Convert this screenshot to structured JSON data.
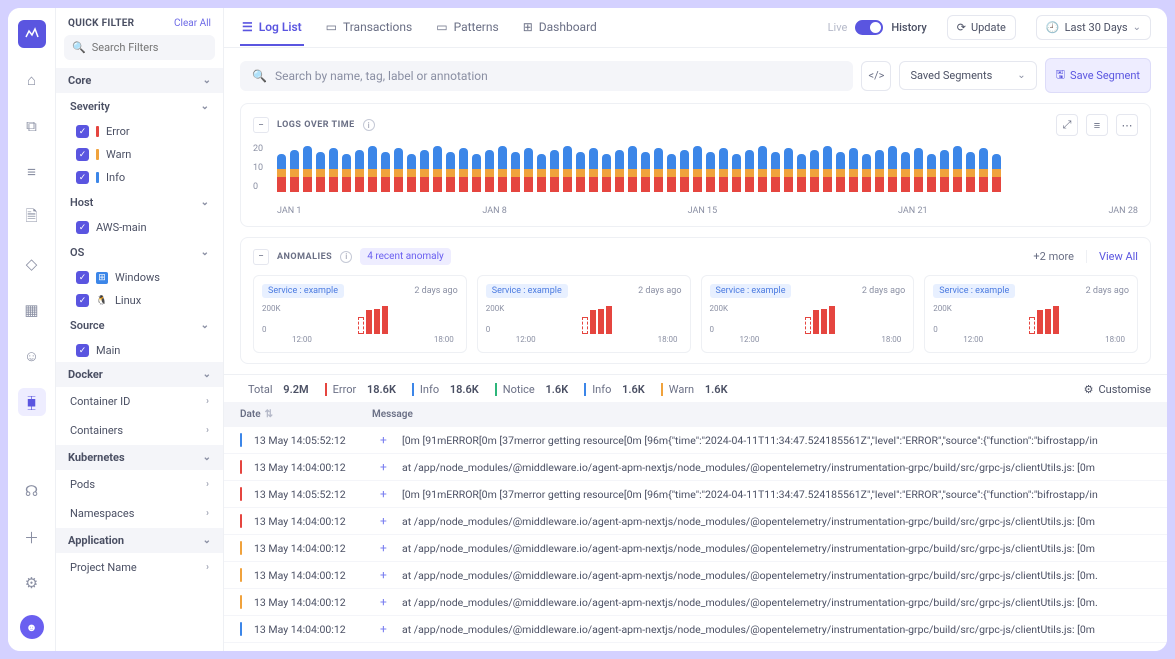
{
  "nav": {
    "items": [
      "home",
      "stack",
      "list",
      "file",
      "bell",
      "grid",
      "bot",
      "chart"
    ],
    "bottom": [
      "headset",
      "plus",
      "settings",
      "avatar"
    ]
  },
  "filter": {
    "title": "QUICK FILTER",
    "clear": "Clear All",
    "search_placeholder": "Search Filters",
    "groups": {
      "core": {
        "label": "Core",
        "severity": {
          "label": "Severity",
          "items": [
            {
              "label": "Error",
              "color": "#e5453f"
            },
            {
              "label": "Warn",
              "color": "#f0a23c"
            },
            {
              "label": "Info",
              "color": "#3c86e8"
            }
          ]
        },
        "host": {
          "label": "Host",
          "items": [
            {
              "label": "AWS-main"
            }
          ]
        },
        "os": {
          "label": "OS",
          "items": [
            {
              "label": "Windows",
              "icon": "⊞",
              "bg": "#3c86e8"
            },
            {
              "label": "Linux",
              "icon": "🐧",
              "bg": "#fff"
            }
          ]
        },
        "source": {
          "label": "Source",
          "items": [
            {
              "label": "Main"
            }
          ]
        }
      },
      "docker": {
        "label": "Docker",
        "links": [
          "Container ID",
          "Containers"
        ]
      },
      "kubernetes": {
        "label": "Kubernetes",
        "links": [
          "Pods",
          "Namespaces"
        ]
      },
      "application": {
        "label": "Application",
        "links": [
          "Project Name"
        ]
      }
    }
  },
  "topbar": {
    "tabs": [
      {
        "label": "Log List",
        "icon": "☰",
        "active": true
      },
      {
        "label": "Transactions",
        "icon": "▭"
      },
      {
        "label": "Patterns",
        "icon": "▭"
      },
      {
        "label": "Dashboard",
        "icon": "⊞"
      }
    ],
    "live": "Live",
    "history": "History",
    "update": "Update",
    "range": "Last 30 Days"
  },
  "searchbar": {
    "placeholder": "Search by name, tag, label or annotation",
    "segments_label": "Saved Segments",
    "save_label": "Save Segment"
  },
  "logs_over_time": {
    "title": "LOGS OVER TIME",
    "y": [
      "20",
      "10",
      "0"
    ],
    "x": [
      "JAN 1",
      "JAN 8",
      "JAN 15",
      "JAN 21",
      "JAN 28"
    ]
  },
  "anomalies": {
    "title": "ANOMALIES",
    "recent": "4 recent anomaly",
    "more": "+2 more",
    "viewall": "View All",
    "cards": [
      {
        "tag": "Service : example",
        "time": "2 days ago",
        "y": [
          "200K",
          "0"
        ],
        "x": [
          "12:00",
          "18:00"
        ]
      },
      {
        "tag": "Service : example",
        "time": "2 days ago",
        "y": [
          "200K",
          "0"
        ],
        "x": [
          "12:00",
          "18:00"
        ]
      },
      {
        "tag": "Service : example",
        "time": "2 days ago",
        "y": [
          "200K",
          "0"
        ],
        "x": [
          "12:00",
          "18:00"
        ]
      },
      {
        "tag": "Service : example",
        "time": "2 days ago",
        "y": [
          "200K",
          "0"
        ],
        "x": [
          "12:00",
          "18:00"
        ]
      }
    ]
  },
  "summary": {
    "total": {
      "lbl": "Total",
      "val": "9.2M"
    },
    "items": [
      {
        "lbl": "Error",
        "val": "18.6K",
        "color": "#e5453f"
      },
      {
        "lbl": "Info",
        "val": "18.6K",
        "color": "#3c86e8"
      },
      {
        "lbl": "Notice",
        "val": "1.6K",
        "color": "#2db57a"
      },
      {
        "lbl": "Info",
        "val": "1.6K",
        "color": "#3c86e8"
      },
      {
        "lbl": "Warn",
        "val": "1.6K",
        "color": "#f0a23c"
      }
    ],
    "customise": "Customise"
  },
  "table": {
    "head": {
      "date": "Date",
      "message": "Message"
    },
    "rows": [
      {
        "bar": "#3c86e8",
        "date": "13 May 14:05:52:12",
        "msg": "[0m [91mERROR[0m [37merror getting resource[0m [96m{\"time\":\"2024-04-11T11:34:47.524185561Z\",\"level\":\"ERROR\",\"source\":{\"function\":\"bifrostapp/in"
      },
      {
        "bar": "#e5453f",
        "date": "13 May 14:04:00:12",
        "msg": "at /app/node_modules/@middleware.io/agent-apm-nextjs/node_modules/@opentelemetry/instrumentation-grpc/build/src/grpc-js/clientUtils.js: [0m"
      },
      {
        "bar": "#e5453f",
        "date": "13 May 14:05:52:12",
        "msg": "[0m [91mERROR[0m [37merror getting resource[0m [96m{\"time\":\"2024-04-11T11:34:47.524185561Z\",\"level\":\"ERROR\",\"source\":{\"function\":\"bifrostapp/in"
      },
      {
        "bar": "#e5453f",
        "date": "13 May 14:04:00:12",
        "msg": "at /app/node_modules/@middleware.io/agent-apm-nextjs/node_modules/@opentelemetry/instrumentation-grpc/build/src/grpc-js/clientUtils.js: [0m"
      },
      {
        "bar": "#f0a23c",
        "date": "13 May 14:04:00:12",
        "msg": "at /app/node_modules/@middleware.io/agent-apm-nextjs/node_modules/@opentelemetry/instrumentation-grpc/build/src/grpc-js/clientUtils.js: [0m"
      },
      {
        "bar": "#f0a23c",
        "date": "13 May 14:04:00:12",
        "msg": "at /app/node_modules/@middleware.io/agent-apm-nextjs/node_modules/@opentelemetry/instrumentation-grpc/build/src/grpc-js/clientUtils.js: [0m."
      },
      {
        "bar": "#f0a23c",
        "date": "13 May 14:04:00:12",
        "msg": "at /app/node_modules/@middleware.io/agent-apm-nextjs/node_modules/@opentelemetry/instrumentation-grpc/build/src/grpc-js/clientUtils.js: [0m."
      },
      {
        "bar": "#3c86e8",
        "date": "13 May 14:04:00:12",
        "msg": "at /app/node_modules/@middleware.io/agent-apm-nextjs/node_modules/@opentelemetry/instrumentation-grpc/build/src/grpc-js/clientUtils.js: [0m"
      }
    ]
  },
  "chart_data": {
    "type": "bar",
    "stacked": true,
    "title": "LOGS OVER TIME",
    "ylabel": "",
    "ylim": [
      0,
      25
    ],
    "yticks": [
      0,
      10,
      20
    ],
    "x_categories_shown": [
      "JAN 1",
      "JAN 8",
      "JAN 15",
      "JAN 21",
      "JAN 28"
    ],
    "series": [
      {
        "name": "Error",
        "color": "#e5453f",
        "value_per_bar": 8
      },
      {
        "name": "Warn",
        "color": "#f0a23c",
        "value_per_bar": 4
      },
      {
        "name": "Info",
        "color": "#3c86e8",
        "value_per_bar": 10
      }
    ],
    "n_bars": 56,
    "anomaly_mini_charts": {
      "type": "bar",
      "ylim": [
        0,
        200000
      ],
      "yticks": [
        "0",
        "200K"
      ],
      "xticks": [
        "12:00",
        "18:00"
      ],
      "bars": [
        120000,
        170000,
        180000,
        200000
      ],
      "dashed_first": true
    }
  }
}
